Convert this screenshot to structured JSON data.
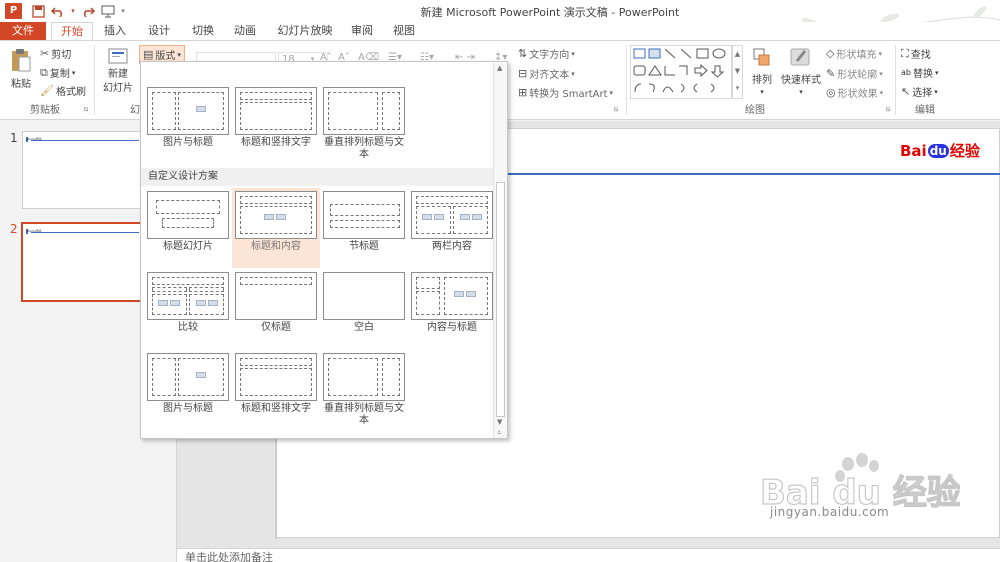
{
  "window": {
    "app_icon": "P",
    "title": "新建 Microsoft PowerPoint 演示文稿 - PowerPoint"
  },
  "qat": [
    "save-icon",
    "undo-icon",
    "redo-icon",
    "present-icon"
  ],
  "tabs": [
    "文件",
    "开始",
    "插入",
    "设计",
    "切换",
    "动画",
    "幻灯片放映",
    "审阅",
    "视图"
  ],
  "ribbon": {
    "clipboard": {
      "paste": "粘贴",
      "cut": "剪切",
      "copy": "复制",
      "format_painter": "格式刷",
      "label": "剪贴板"
    },
    "slides": {
      "new_slide": "新建",
      "new_slide2": "幻灯片",
      "layout": "版式",
      "label_partial": "幻"
    },
    "font": {
      "size": "18"
    },
    "paragraph": {
      "text_direction": "文字方向",
      "align_text": "对齐文本",
      "smartart": "转换为 SmartArt"
    },
    "drawing": {
      "arrange": "排列",
      "quick_styles": "快速样式",
      "shape_fill": "形状填充",
      "shape_outline": "形状轮廓",
      "shape_effects": "形状效果",
      "label": "绘图"
    },
    "editing": {
      "find": "查找",
      "replace": "替换",
      "select": "选择",
      "label": "编辑"
    }
  },
  "thumbnails": [
    {
      "num": "1",
      "title": "Baidu经验"
    },
    {
      "num": "2",
      "title": "Baidu经验"
    }
  ],
  "logo": {
    "bai": "Bai",
    "du": "du",
    "jingyan": "经验"
  },
  "gallery": {
    "row0": [
      "图片与标题",
      "标题和竖排文字",
      "垂直排列标题与文本"
    ],
    "section": "自定义设计方案",
    "row1": [
      "标题幻灯片",
      "标题和内容",
      "节标题",
      "两栏内容"
    ],
    "row2": [
      "比较",
      "仅标题",
      "空白",
      "内容与标题"
    ],
    "row3": [
      "图片与标题",
      "标题和竖排文字",
      "垂直排列标题与文本"
    ]
  },
  "notes": "单击此处添加备注",
  "watermark": {
    "brand": "Bai du 经验",
    "url": "jingyan.baidu.com"
  },
  "colors": {
    "accent": "#d24726",
    "blue": "#3c6ebd",
    "highlight": "#fce4d6"
  }
}
